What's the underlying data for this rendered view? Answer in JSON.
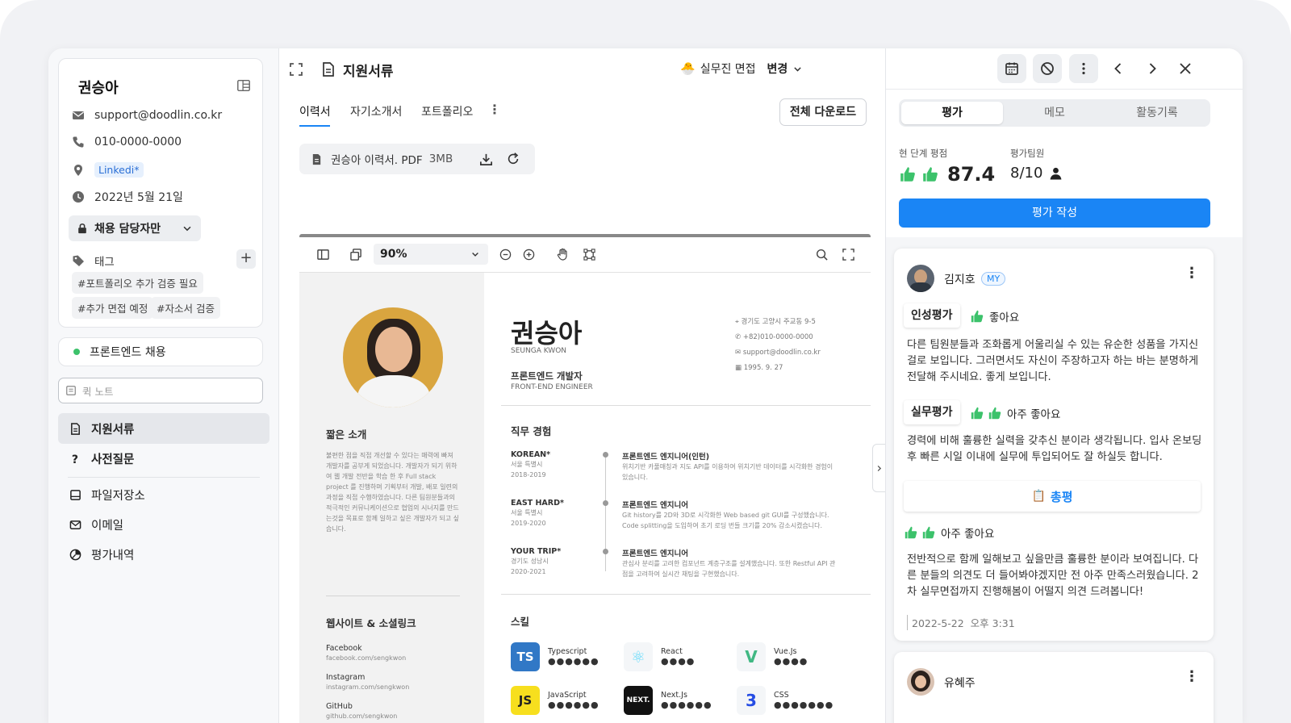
{
  "candidate": {
    "name": "권승아",
    "email": "support@doodlin.co.kr",
    "phone": "010-0000-0000",
    "link": "Linkedi*",
    "date": "2022년 5월 21일",
    "visibility": "채용 담당자만",
    "tag_label": "태그",
    "tags": [
      "#포트폴리오 추가 검증 필요",
      "#추가 면접 예정",
      "#자소서 검증"
    ],
    "position": "프론트엔드 채용",
    "quick_note_placeholder": "퀵 노트"
  },
  "nav": {
    "documents": "지원서류",
    "questions": "사전질문",
    "storage": "파일저장소",
    "email": "이메일",
    "evaluations": "평가내역"
  },
  "header": {
    "title": "지원서류",
    "stage_emoji": "🐣",
    "stage": "실무진 면접",
    "change": "변경"
  },
  "doc_tabs": {
    "resume": "이력서",
    "cover": "자기소개서",
    "portfolio": "포트폴리오",
    "download_all": "전체 다운로드"
  },
  "file": {
    "name": "권승아 이력서. PDF",
    "size": "3MB"
  },
  "viewer": {
    "zoom": "90%"
  },
  "resume": {
    "name_ko": "권승아",
    "name_en": "SEUNGA KWON",
    "role_ko": "프론트엔드 개발자",
    "role_en": "FRONT-END ENGINEER",
    "contact": {
      "address": "경기도 고양시 주교동 9-5",
      "phone": "+82)010-0000-0000",
      "email": "support@doodlin.co.kr",
      "birth": "1995. 9. 27"
    },
    "intro_title": "짧은 소개",
    "intro_text": "불편한 점을 직접 개선할 수 있다는 매력에 빠져 개발자를 공부게 되었습니다. 개발자가 되기 위하여 웹 개발 전반을 학습 한 후 Full stack project 를 진행하며 기획부터 개발, 배포 일련의 과정을 직접 수행하였습니다. 다른 팀원분들과의 적극적인 커뮤니케이션으로 협업의 시너지를 만드는것을 목표로 함께 일하고 싶은 개발자가 되고 싶습니다.",
    "links_title": "웹사이트 & 소셜링크",
    "links": [
      {
        "name": "Facebook",
        "url": "facebook.com/sengkwon"
      },
      {
        "name": "Instagram",
        "url": "instagram.com/sengkwon"
      },
      {
        "name": "GitHub",
        "url": "github.com/sengkwon"
      }
    ],
    "exp_title": "직무 경험",
    "experience": [
      {
        "company": "KOREAN*",
        "loc": "서울 특별시",
        "period": "2018-2019",
        "title": "프론트엔드 엔지니어(인턴)",
        "desc": "위치기반 카풀매칭과 지도 API를 이용하여 위치기반 데이터를 시각화한 경험이 있습니다."
      },
      {
        "company": "EAST HARD*",
        "loc": "서울 특별시",
        "period": "2019-2020",
        "title": "프론트엔드 엔지니어",
        "desc": "Git history를 2D와 3D로 시각화한 Web based git GUI를 구성했습니다. Code splitting을 도입하여 초기 로딩 번들 크기를 20% 감소시켰습니다."
      },
      {
        "company": "YOUR TRIP*",
        "loc": "경기도 성남시",
        "period": "2020-2021",
        "title": "프론트엔드 엔지니어",
        "desc": "관심사 분리를 고려한 컴포넌트 계층구조를 설계했습니다. 또한 Restful API 관점을 고려하여 실시간 채팅을 구현했습니다."
      }
    ],
    "skills_title": "스킬",
    "skills": [
      {
        "name": "Typescript",
        "logo": "TS",
        "dots": "●●●●●●",
        "bg": "#3178c6",
        "fg": "#ffffff"
      },
      {
        "name": "React",
        "logo": "⚛",
        "dots": "●●●●",
        "bg": "#f4f6f8",
        "fg": "#61dafb"
      },
      {
        "name": "Vue.Js",
        "logo": "V",
        "dots": "●●●●",
        "bg": "#f4f6f8",
        "fg": "#41b883"
      },
      {
        "name": "JavaScript",
        "logo": "JS",
        "dots": "●●●●●●",
        "bg": "#f7df1e",
        "fg": "#222222"
      },
      {
        "name": "Next.Js",
        "logo": "NEXT.",
        "dots": "●●●●●●",
        "bg": "#111111",
        "fg": "#ffffff"
      },
      {
        "name": "CSS",
        "logo": "3",
        "dots": "●●●●●●●",
        "bg": "#f4f6f8",
        "fg": "#264de4"
      }
    ]
  },
  "eval": {
    "tabs": [
      "평가",
      "메모",
      "활동기록"
    ],
    "stage_score_label": "현 단계 평점",
    "score": "87.4",
    "team_label": "평가팀원",
    "team": "8/10",
    "write_button": "평가 작성",
    "reviews": [
      {
        "name": "김지호",
        "me_badge": "MY",
        "personality_label": "인성평가",
        "personality_rating": "좋아요",
        "personality_text": "다른 팀원분들과 조화롭게 어울리실 수 있는 유순한 성품을 가지신 걸로 보입니다. 그러면서도 자신이 주장하고자 하는 바는 분명하게 전달해 주시네요. 좋게 보입니다.",
        "practical_label": "실무평가",
        "practical_rating": "아주 좋아요",
        "practical_text": "경력에 비해 훌륭한 실력을 갖추신 분이라 생각됩니다. 입사 온보딩 후 빠른 시일 이내에 실무에 투입되어도 잘 하실듯 합니다.",
        "summary_label": "총평",
        "summary_emoji": "📋",
        "summary_rating": "아주 좋아요",
        "summary_text": "전반적으로 함께 일해보고 싶을만큼 훌륭한 분이라 보여집니다. 다른 분들의 의견도 더 들어봐야겠지만 전 아주 만족스러웠습니다. 2차 실무면접까지 진행해봄이 어떨지 의견 드려봅니다!",
        "timestamp": "2022-5-22  오후 3:31"
      },
      {
        "name": "유혜주"
      }
    ]
  },
  "colors": {
    "accent": "#1a85f5",
    "thumb": "#3cc26b",
    "position_dot": "#3cc26b"
  }
}
